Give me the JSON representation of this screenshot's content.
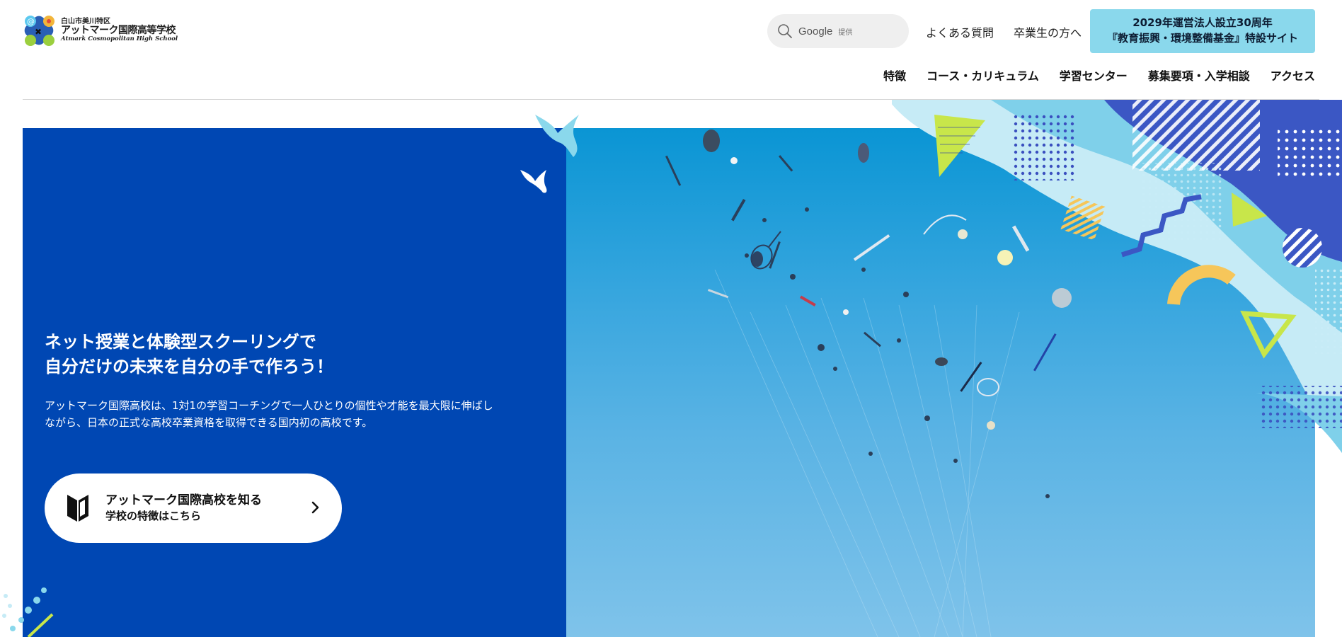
{
  "brand": {
    "logo_small": "白山市美川特区",
    "logo_main": "アットマーク国際高等学校",
    "logo_en": "Atmark Cosmopolitan High School"
  },
  "search": {
    "brand": "Google",
    "provided": "提供"
  },
  "utility_nav": {
    "faq": "よくある質問",
    "alumni": "卒業生の方へ"
  },
  "anniversary_cta": {
    "line1": "2029年運営法人設立30周年",
    "line2": "『教育振興・環境整備基金』特設サイト",
    "background_color": "#8ad8ec"
  },
  "global_nav": [
    {
      "label": "特徴"
    },
    {
      "label": "コース・カリキュラム"
    },
    {
      "label": "学習センター"
    },
    {
      "label": "募集要項・入学相談"
    },
    {
      "label": "アクセス"
    }
  ],
  "hero": {
    "headline_line1": "ネット授業と体験型スクーリングで",
    "headline_line2": "自分だけの未来を自分の手で作ろう！",
    "description_line1": "アットマーク国際高校は、1対1の学習コーチングで一人ひとりの個性や才能を最大限に伸ばし",
    "description_line2": "ながら、日本の正式な高校卒業資格を取得できる国内初の高校です。",
    "cta_title": "アットマーク国際高校を知る",
    "cta_subtitle": "学校の特徴はこちら",
    "panel_color": "#0047b3"
  },
  "icons": [
    "logo-mark",
    "search-icon",
    "beginner-mark-icon",
    "chevron-right-icon",
    "bird-icon"
  ]
}
